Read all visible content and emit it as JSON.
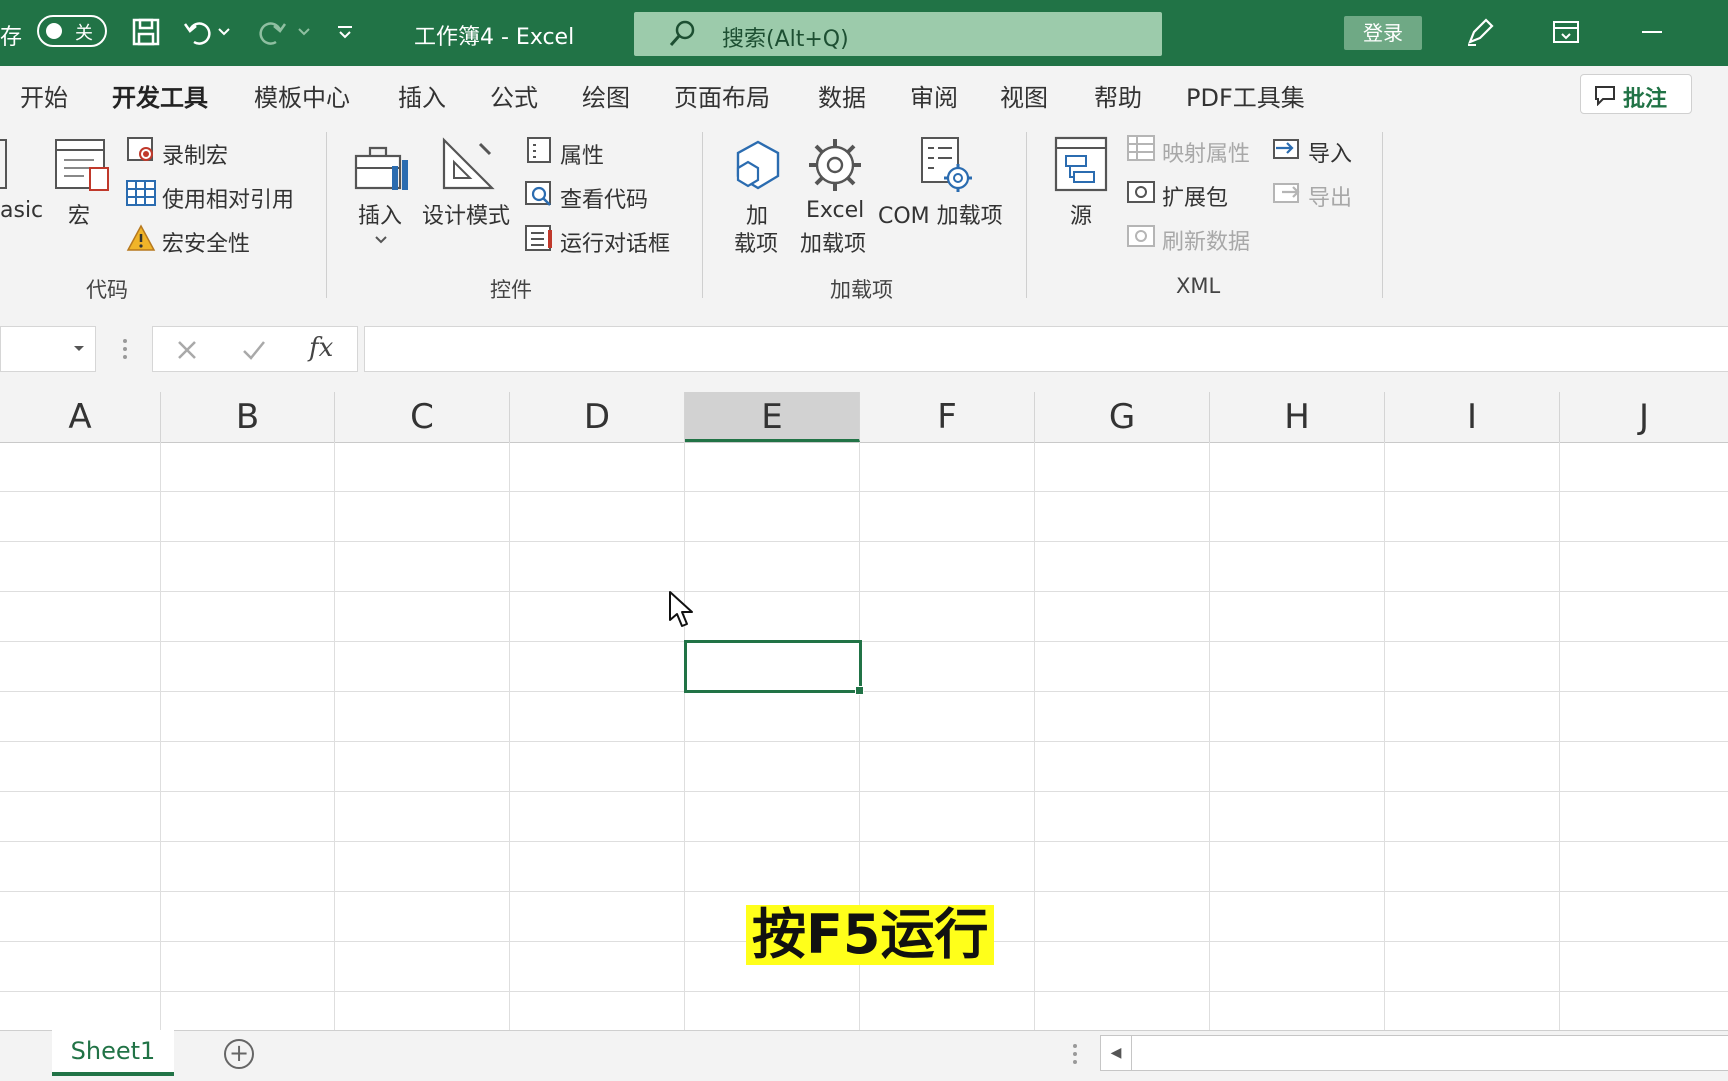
{
  "titlebar": {
    "autosave_label": "存",
    "toggle_state": "关",
    "title": "工作簿4 - Excel",
    "search_placeholder": "搜索(Alt+Q)",
    "login": "登录",
    "colors": {
      "bar": "#217346",
      "search": "#9ccbab"
    }
  },
  "tabs": {
    "items": [
      "开始",
      "开发工具",
      "模板中心",
      "插入",
      "公式",
      "绘图",
      "页面布局",
      "数据",
      "审阅",
      "视图",
      "帮助",
      "PDF工具集"
    ],
    "active": "开发工具",
    "comment": "批注"
  },
  "ribbon": {
    "code": {
      "basic_partial": "asic",
      "macro": "宏",
      "record_macro": "录制宏",
      "relative_ref": "使用相对引用",
      "macro_security": "宏安全性",
      "label": "代码"
    },
    "controls": {
      "insert": "插入",
      "design_mode": "设计模式",
      "properties": "属性",
      "view_code": "查看代码",
      "run_dialog": "运行对话框",
      "label": "控件"
    },
    "addins": {
      "addin_line1": "加",
      "addin_line2": "载项",
      "excel_line1": "Excel",
      "excel_line2": "加载项",
      "com_addin": "COM 加载项",
      "label": "加载项"
    },
    "xml": {
      "source": "源",
      "map_props": "映射属性",
      "expansion": "扩展包",
      "refresh": "刷新数据",
      "import": "导入",
      "export": "导出",
      "label": "XML"
    }
  },
  "formula_bar": {
    "fx": "fx"
  },
  "grid": {
    "columns": [
      "A",
      "B",
      "C",
      "D",
      "E",
      "F",
      "G",
      "H",
      "I",
      "J"
    ],
    "selected_column": "E",
    "caption": "按F5运行"
  },
  "sheets": {
    "tabs": [
      "Sheet1"
    ],
    "add": "+"
  }
}
